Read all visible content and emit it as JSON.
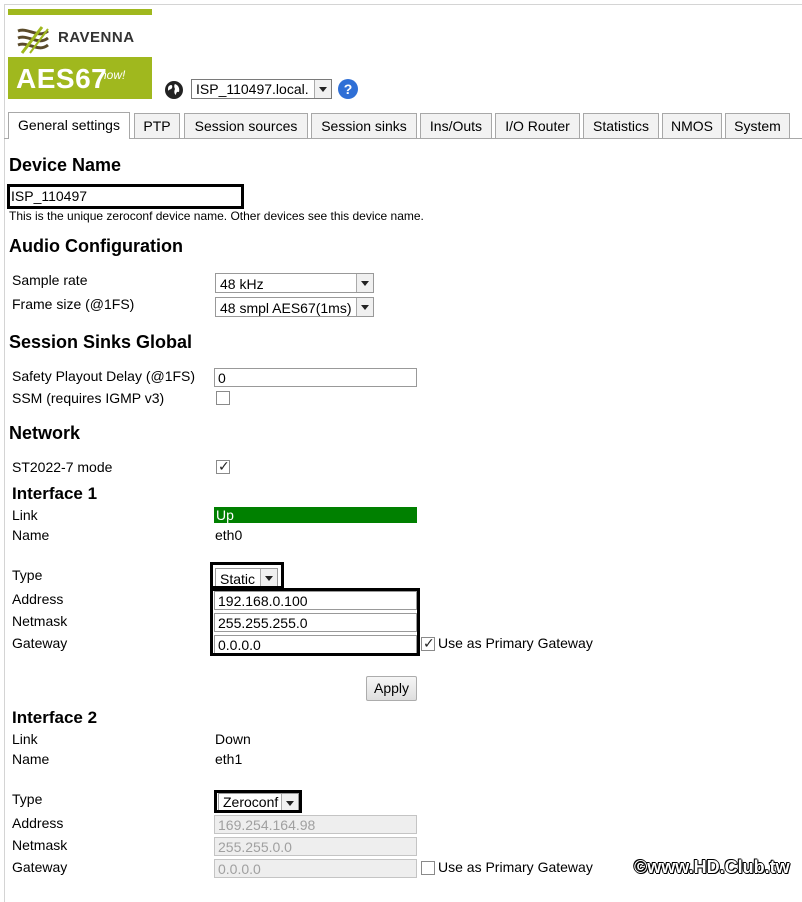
{
  "brand": {
    "name": "RAVENNA",
    "product": "AES67",
    "tagline": "now!"
  },
  "device_select": {
    "value": "ISP_110497.local."
  },
  "tabs": [
    {
      "label": "General settings"
    },
    {
      "label": "PTP"
    },
    {
      "label": "Session sources"
    },
    {
      "label": "Session sinks"
    },
    {
      "label": "Ins/Outs"
    },
    {
      "label": "I/O Router"
    },
    {
      "label": "Statistics"
    },
    {
      "label": "NMOS"
    },
    {
      "label": "System"
    }
  ],
  "device_name": {
    "heading": "Device Name",
    "value": "ISP_110497",
    "hint": "This is the unique zeroconf device name. Other devices see this device name."
  },
  "audio": {
    "heading": "Audio Configuration",
    "sample_rate_label": "Sample rate",
    "sample_rate": "48 kHz",
    "frame_size_label": "Frame size (@1FS)",
    "frame_size": "48 smpl AES67(1ms)"
  },
  "sinks": {
    "heading": "Session Sinks Global",
    "delay_label": "Safety Playout Delay (@1FS)",
    "delay": "0",
    "ssm_label": "SSM (requires IGMP v3)",
    "ssm_checked": false
  },
  "network": {
    "heading": "Network",
    "st2022_label": "ST2022-7 mode",
    "st2022_checked": true
  },
  "interface1": {
    "heading": "Interface 1",
    "link_label": "Link",
    "link": "Up",
    "name_label": "Name",
    "name": "eth0",
    "type_label": "Type",
    "type": "Static",
    "address_label": "Address",
    "address": "192.168.0.100",
    "netmask_label": "Netmask",
    "netmask": "255.255.255.0",
    "gateway_label": "Gateway",
    "gateway": "0.0.0.0",
    "primary_gw_label": "Use as Primary Gateway",
    "primary_gw_checked": true,
    "apply_label": "Apply"
  },
  "interface2": {
    "heading": "Interface 2",
    "link_label": "Link",
    "link": "Down",
    "name_label": "Name",
    "name": "eth1",
    "type_label": "Type",
    "type": "Zeroconf",
    "address_label": "Address",
    "address": "169.254.164.98",
    "netmask_label": "Netmask",
    "netmask": "255.255.0.0",
    "gateway_label": "Gateway",
    "gateway": "0.0.0.0",
    "primary_gw_label": "Use as Primary Gateway",
    "primary_gw_checked": false
  },
  "watermark": "©www.HD.Club.tw",
  "colors": {
    "brand_green": "#a0b81e",
    "link_up": "#008000",
    "help_blue": "#2f6fd6"
  }
}
